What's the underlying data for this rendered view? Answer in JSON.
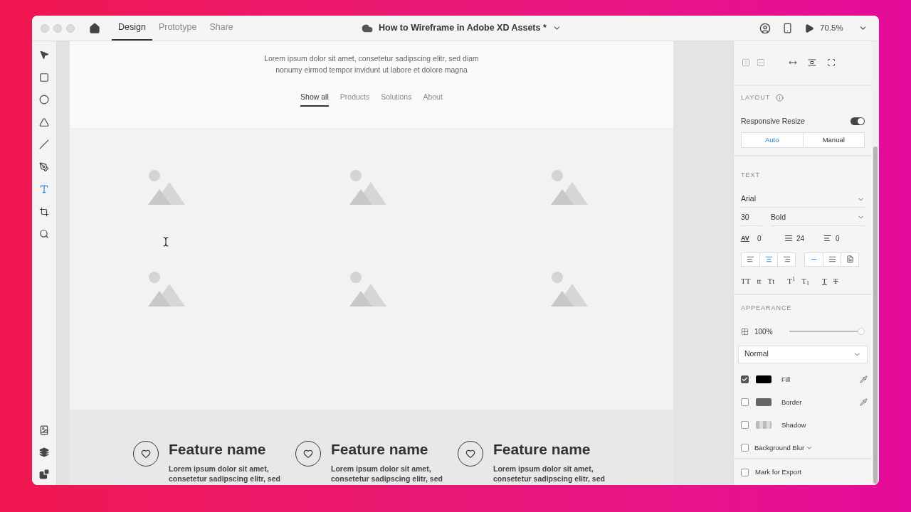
{
  "window": {
    "title": "How to Wireframe in Adobe XD Assets *",
    "zoom": "70.5%"
  },
  "tabs": [
    {
      "label": "Design",
      "selected": true
    },
    {
      "label": "Prototype",
      "selected": false
    },
    {
      "label": "Share",
      "selected": false
    }
  ],
  "tools": [
    {
      "kind": "select",
      "selected": false
    },
    {
      "kind": "rectangle",
      "selected": false
    },
    {
      "kind": "ellipse",
      "selected": false
    },
    {
      "kind": "polygon",
      "selected": false
    },
    {
      "kind": "line",
      "selected": false
    },
    {
      "kind": "pen",
      "selected": false
    },
    {
      "kind": "text",
      "selected": true
    },
    {
      "kind": "artboard",
      "selected": false
    },
    {
      "kind": "zoom",
      "selected": false
    }
  ],
  "artboard": {
    "intro": "Lorem ipsum dolor sit amet, consetetur sadipscing elitr, sed diam nonumy eirmod tempor invidunt ut labore et dolore magna",
    "nav": [
      {
        "label": "Show all",
        "selected": true
      },
      {
        "label": "Products",
        "selected": false
      },
      {
        "label": "Solutions",
        "selected": false
      },
      {
        "label": "About",
        "selected": false
      }
    ],
    "features": [
      {
        "title": "Feature name",
        "text": "Lorem ipsum dolor sit amet, consetetur sadipscing elitr, sed"
      },
      {
        "title": "Feature name",
        "text": "Lorem ipsum dolor sit amet, consetetur sadipscing elitr, sed"
      },
      {
        "title": "Feature name",
        "text": "Lorem ipsum dolor sit amet, consetetur sadipscing elitr, sed"
      }
    ]
  },
  "layout": {
    "heading": "LAYOUT",
    "responsive_resize": {
      "label": "Responsive Resize",
      "on": true
    },
    "modes": [
      {
        "label": "Auto",
        "selected": true
      },
      {
        "label": "Manual",
        "selected": false
      }
    ]
  },
  "text": {
    "heading": "TEXT",
    "font": "Arial",
    "size": "30",
    "weight": "Bold",
    "char_spacing_icon": "AV",
    "char_spacing": "0",
    "line_spacing": "24",
    "paragraph_spacing": "0",
    "align": [
      {
        "kind": "left",
        "selected": false
      },
      {
        "kind": "center",
        "selected": true
      },
      {
        "kind": "right",
        "selected": false
      }
    ],
    "box": [
      {
        "kind": "auto-width",
        "selected": true
      },
      {
        "kind": "auto-height",
        "selected": false
      },
      {
        "kind": "fixed",
        "selected": false
      }
    ],
    "styles": [
      "TT",
      "tt",
      "Tt",
      "T$^{1}$",
      "T$_{1}$",
      "T",
      "T"
    ]
  },
  "appearance": {
    "heading": "APPEARANCE",
    "opacity": "100%",
    "level": 1,
    "blend": "Normal",
    "layers": [
      {
        "kind": "swatch",
        "label": "Fill",
        "checked": true,
        "color": "#000000",
        "picker": true
      },
      {
        "kind": "swatch",
        "label": "Border",
        "checked": false,
        "color": "#666666",
        "picker": true
      },
      {
        "kind": "shadow",
        "label": "Shadow",
        "checked": false,
        "picker": false
      },
      {
        "kind": "menu",
        "label": "Background Blur",
        "checked": false,
        "picker": false
      }
    ]
  },
  "export": {
    "label": "Mark for Export",
    "checked": false
  }
}
